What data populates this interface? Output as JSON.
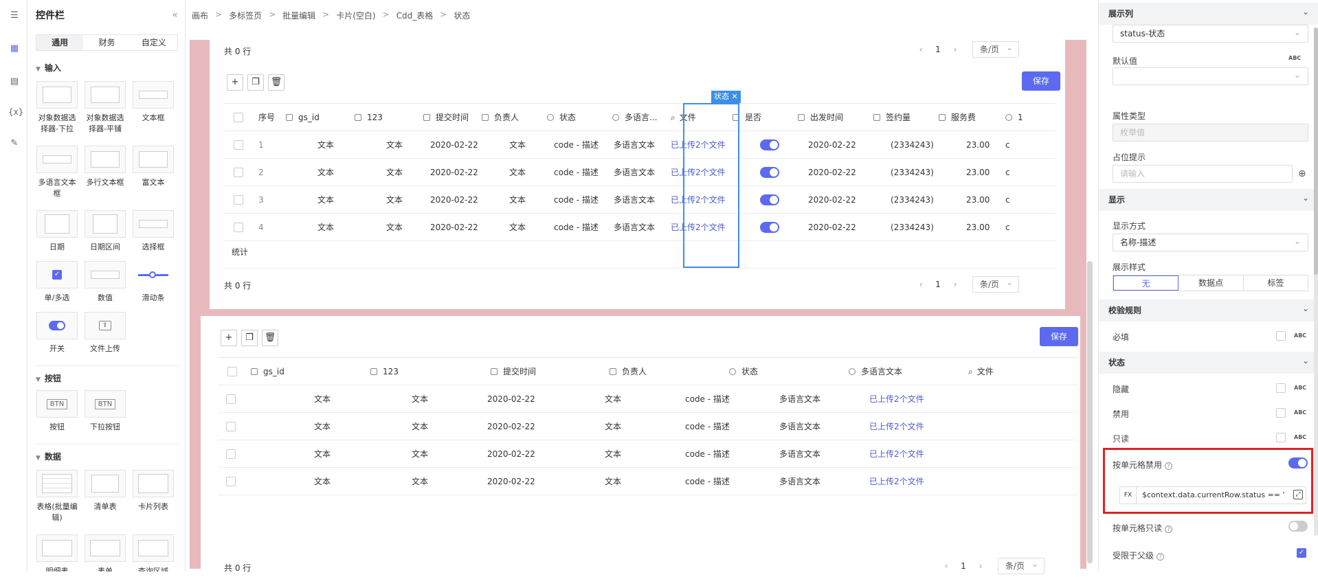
{
  "panel": {
    "title": "控件栏",
    "collapse": "«",
    "tabs": [
      "通用",
      "财务",
      "自定义"
    ],
    "sections": {
      "input": "输入",
      "button": "按钮",
      "data": "数据"
    },
    "widgets_input": [
      "对象数据选择器-下拉",
      "对象数据选择器-平铺",
      "文本框",
      "多语言文本框",
      "多行文本框",
      "富文本",
      "日期",
      "日期区间",
      "选择框",
      "单/多选",
      "数值",
      "滑动条",
      "开关",
      "文件上传"
    ],
    "widgets_button": [
      "按钮",
      "下拉按钮"
    ],
    "button_icon_texts": [
      "BTN",
      "BTN"
    ],
    "widgets_data": [
      "表格(批量编辑)",
      "清单表",
      "卡片列表",
      "明细表",
      "表单",
      "查询区域"
    ]
  },
  "breadcrumb": [
    "画布",
    "多标签页",
    "批量编辑",
    "卡片(空白)",
    "Cdd_表格",
    "状态"
  ],
  "breadcrumb_sep": ">",
  "table1": {
    "total": "共 0 行",
    "page": "1",
    "page_size": "条/页",
    "save": "保存",
    "selected_tag": "状态 ✕",
    "headers": [
      "序号",
      "gs_id",
      "123",
      "提交时间",
      "负责人",
      "状态",
      "多语言...",
      "文件",
      "是否",
      "出发时间",
      "签约量",
      "服务费",
      "1"
    ],
    "rows": [
      [
        "1",
        "文本",
        "文本",
        "2020-02-22",
        "文本",
        "code - 描述",
        "多语言文本",
        "已上传2个文件",
        "",
        "2020-02-22",
        "(2334243)",
        "23.00",
        "c"
      ],
      [
        "2",
        "文本",
        "文本",
        "2020-02-22",
        "文本",
        "code - 描述",
        "多语言文本",
        "已上传2个文件",
        "",
        "2020-02-22",
        "(2334243)",
        "23.00",
        "c"
      ],
      [
        "3",
        "文本",
        "文本",
        "2020-02-22",
        "文本",
        "code - 描述",
        "多语言文本",
        "已上传2个文件",
        "",
        "2020-02-22",
        "(2334243)",
        "23.00",
        "c"
      ],
      [
        "4",
        "文本",
        "文本",
        "2020-02-22",
        "文本",
        "code - 描述",
        "多语言文本",
        "已上传2个文件",
        "",
        "2020-02-22",
        "(2334243)",
        "23.00",
        "c"
      ]
    ],
    "stat": "统计"
  },
  "table2": {
    "total": "共 0 行",
    "page": "1",
    "page_size": "条/页",
    "save": "保存",
    "headers": [
      "gs_id",
      "123",
      "提交时间",
      "负责人",
      "状态",
      "多语言文本",
      "文件"
    ],
    "rows": [
      [
        "文本",
        "文本",
        "2020-02-22",
        "文本",
        "code - 描述",
        "多语言文本",
        "已上传2个文件"
      ],
      [
        "文本",
        "文本",
        "2020-02-22",
        "文本",
        "code - 描述",
        "多语言文本",
        "已上传2个文件"
      ],
      [
        "文本",
        "文本",
        "2020-02-22",
        "文本",
        "code - 描述",
        "多语言文本",
        "已上传2个文件"
      ],
      [
        "文本",
        "文本",
        "2020-02-22",
        "文本",
        "code - 描述",
        "多语言文本",
        "已上传2个文件"
      ]
    ]
  },
  "props": {
    "display_col": "展示列",
    "display_col_value": "status-状态",
    "default_label": "默认值",
    "abc": "ABC",
    "attr_type_label": "属性类型",
    "attr_type_value": "枚举值",
    "placeholder_label": "占位提示",
    "placeholder_input": "请输入",
    "display_section": "显示",
    "display_mode_label": "显示方式",
    "display_mode_value": "名称-描述",
    "display_style_label": "展示样式",
    "display_style_options": [
      "无",
      "数据点",
      "标签"
    ],
    "validation_section": "校验规则",
    "required_label": "必填",
    "state_section": "状态",
    "hidden_label": "隐藏",
    "disabled_label": "禁用",
    "readonly_label": "只读",
    "cell_disabled_label": "按单元格禁用",
    "fx_label": "FX",
    "fx_expr": "$context.data.currentRow.status == '/",
    "cell_readonly_label": "按单元格只读",
    "parent_limit_label": "受限于父级",
    "help": "?"
  },
  "colors": {
    "accent": "#5b6af0",
    "canvas_bg": "#e8b9bc",
    "select_blue": "#3d8fe6",
    "highlight_red": "#e02020"
  }
}
